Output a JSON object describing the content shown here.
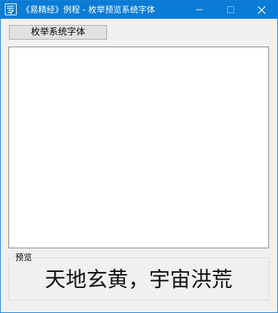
{
  "window": {
    "title": "《易精经》例程 - 枚举预览系统字体",
    "app_icon": "yi-app-icon",
    "controls": {
      "minimize_icon": "minimize-icon",
      "maximize_icon": "maximize-icon",
      "close_icon": "close-icon"
    }
  },
  "toolbar": {
    "enumerate_label": "枚举系统字体"
  },
  "font_list": {
    "items": []
  },
  "preview": {
    "group_label": "预览",
    "sample_text": "天地玄黄，宇宙洪荒"
  },
  "colors": {
    "titlebar": "#0a7bd6",
    "window_bg": "#f0f0f0",
    "list_bg": "#ffffff"
  }
}
